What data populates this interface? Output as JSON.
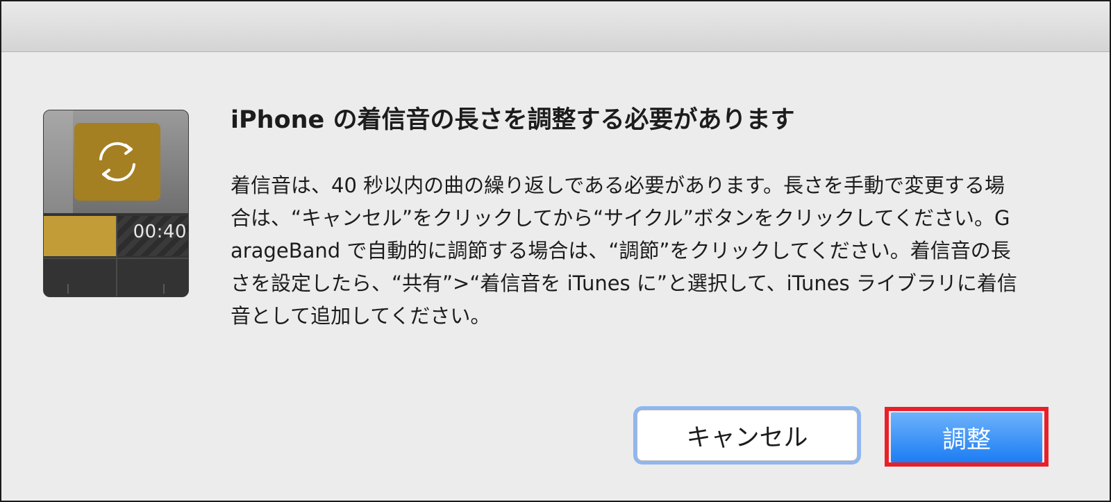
{
  "dialog": {
    "title": "iPhone の着信音の長さを調整する必要があります",
    "message": "着信音は、40 秒以内の曲の繰り返しである必要があります。長さを手動で変更する場合は、“キャンセル”をクリックしてから“サイクル”ボタンをクリックしてください。GarageBand で自動的に調節する場合は、“調節”をクリックしてください。着信音の長さを設定したら、“共有”>“着信音を iTunes に”と選択して、iTunes ライブラリに着信音として追加してください。"
  },
  "icon": {
    "name": "garageband-cycle-region-icon",
    "time_label": "00:40",
    "accent_color": "#a58022"
  },
  "buttons": {
    "cancel_label": "キャンセル",
    "adjust_label": "調整"
  },
  "annotation": {
    "highlight_color": "#e8202a"
  },
  "colors": {
    "default_button": "#1c7df3",
    "background": "#ececec"
  }
}
